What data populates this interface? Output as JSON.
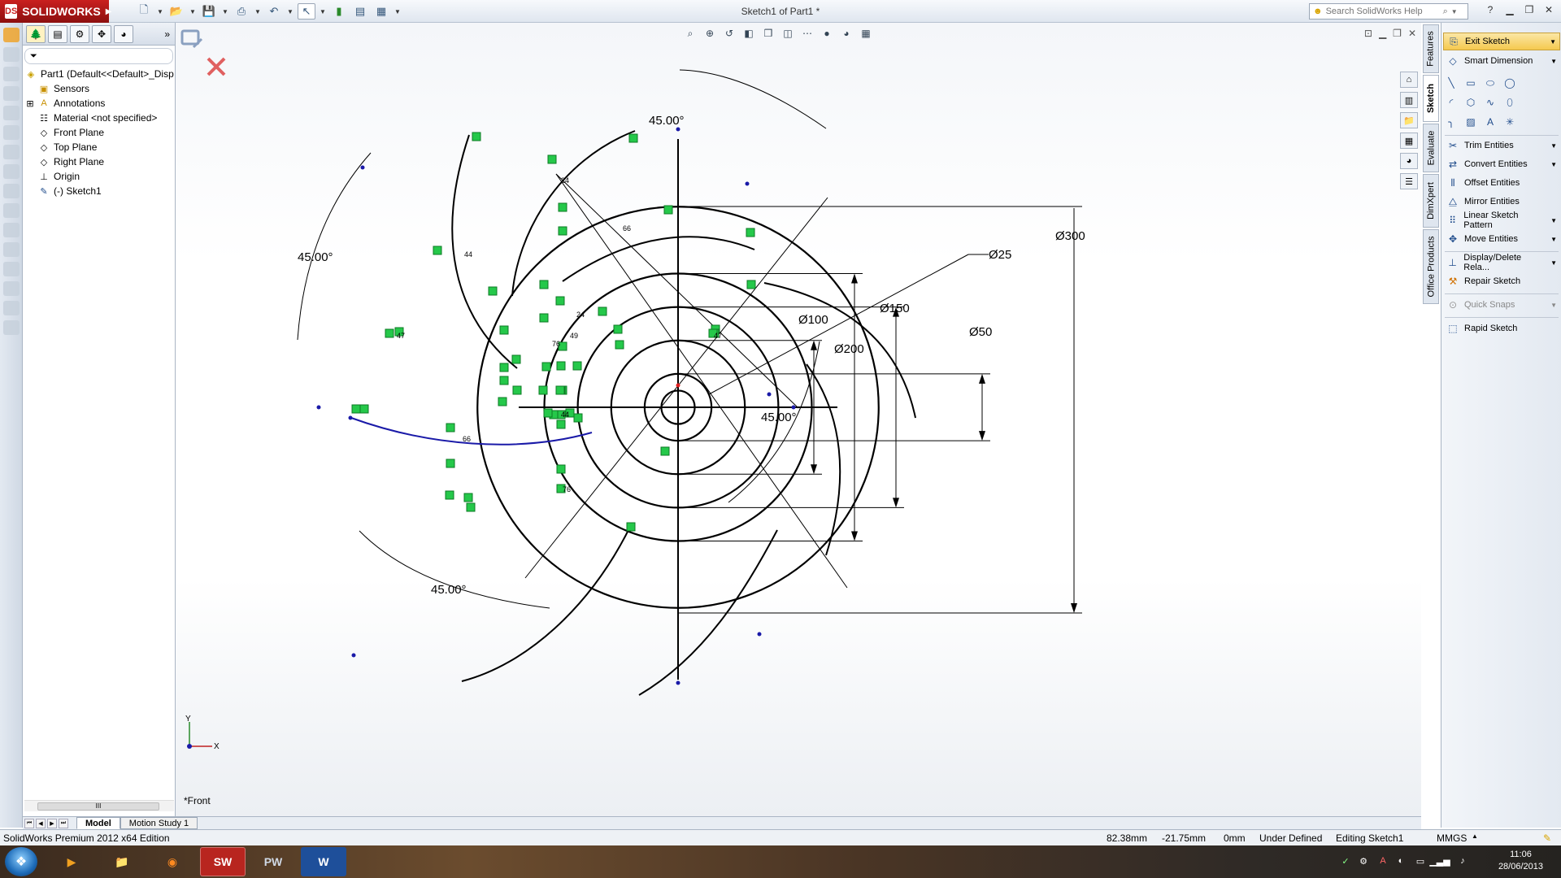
{
  "app": {
    "brand": "SOLIDWORKS",
    "brand_mark": "DS",
    "document_title": "Sketch1 of Part1 *",
    "search_placeholder": "Search SolidWorks Help"
  },
  "feature_tree": {
    "root": "Part1  (Default<<Default>_Disp",
    "items": [
      {
        "label": "Sensors",
        "icon": "sensor-icon"
      },
      {
        "label": "Annotations",
        "icon": "annotation-icon"
      },
      {
        "label": "Material <not specified>",
        "icon": "material-icon"
      },
      {
        "label": "Front Plane",
        "icon": "plane-icon"
      },
      {
        "label": "Top Plane",
        "icon": "plane-icon"
      },
      {
        "label": "Right Plane",
        "icon": "plane-icon"
      },
      {
        "label": "Origin",
        "icon": "origin-icon"
      },
      {
        "label": "(-) Sketch1",
        "icon": "sketch-icon"
      }
    ],
    "scroll_thumb": "III"
  },
  "sketch": {
    "view_label": "*Front",
    "triad_y": "Y",
    "triad_x": "X",
    "angle_label": "45.00°",
    "diameters": {
      "d300": "300",
      "d200": "200",
      "d150": "150",
      "d100": "100",
      "d50": "50",
      "d25": "25"
    },
    "diameter_symbol": "Ø",
    "tags": {
      "t24a": "24",
      "t24b": "24",
      "t44a": "44",
      "t44b": "44",
      "t66a": "66",
      "t66b": "66",
      "t76a": "76",
      "t76b": "76",
      "t47a": "47",
      "t47b": "47",
      "t49": "49"
    }
  },
  "task_tabs": [
    "Features",
    "Sketch",
    "Evaluate",
    "DimXpert",
    "Office Products"
  ],
  "command_manager": {
    "exit_sketch": "Exit Sketch",
    "smart_dimension": "Smart Dimension",
    "trim_entities": "Trim Entities",
    "convert_entities": "Convert Entities",
    "offset_entities": "Offset Entities",
    "mirror_entities": "Mirror Entities",
    "linear_pattern": "Linear Sketch Pattern",
    "move_entities": "Move Entities",
    "display_relations": "Display/Delete Rela...",
    "repair_sketch": "Repair Sketch",
    "quick_snaps": "Quick Snaps",
    "rapid_sketch": "Rapid Sketch"
  },
  "bottom_tabs": [
    "Model",
    "Motion Study 1"
  ],
  "status_bar": {
    "edition": "SolidWorks Premium 2012 x64 Edition",
    "x": "82.38mm",
    "y": "-21.75mm",
    "z": "0mm",
    "state": "Under Defined",
    "mode": "Editing Sketch1",
    "units": "MMGS"
  },
  "taskbar": {
    "time": "11:06",
    "date": "28/06/2013",
    "apps": [
      "media-player",
      "explorer",
      "firefox",
      "SW",
      "PW",
      "W"
    ]
  },
  "colors": {
    "sketch_line": "#000000",
    "construction": "#000000",
    "selected": "#1a1aa8",
    "relation": "#25c84a",
    "brand_red": "#c9201f"
  }
}
